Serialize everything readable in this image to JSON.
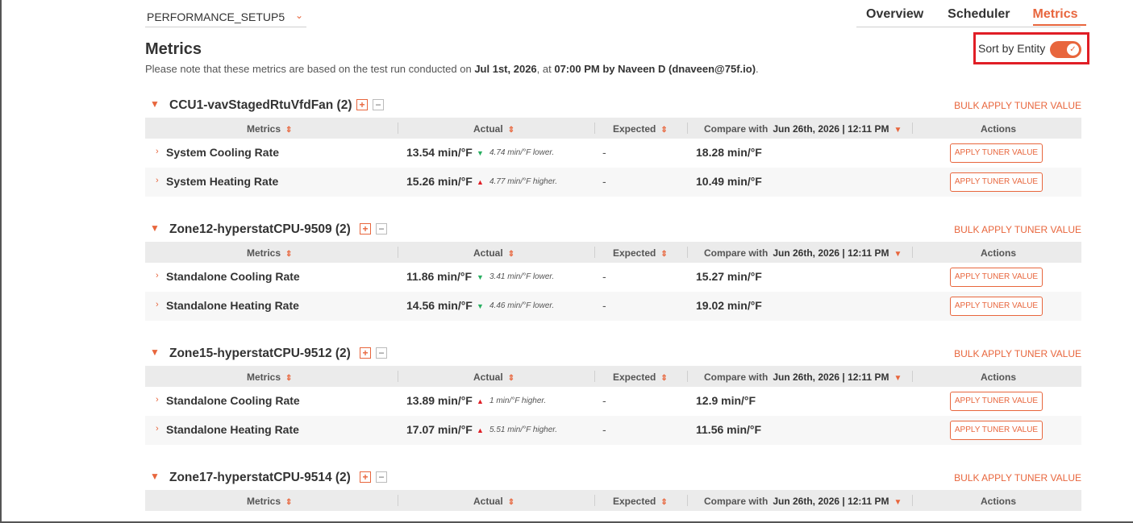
{
  "header": {
    "setup_select": "PERFORMANCE_SETUP5",
    "tabs": [
      {
        "label": "Overview",
        "active": false
      },
      {
        "label": "Scheduler",
        "active": false
      },
      {
        "label": "Metrics",
        "active": true
      }
    ]
  },
  "page": {
    "title": "Metrics",
    "note_prefix": "Please note that these metrics are based on the test run conducted on ",
    "note_date": "Jul 1st, 2026",
    "note_mid": ", at ",
    "note_time": "07:00 PM",
    "note_by": " by ",
    "note_user": "Naveen D (dnaveen@75f.io)",
    "note_suffix": "."
  },
  "sort": {
    "label": "Sort by Entity",
    "enabled": true
  },
  "table_headers": {
    "metrics": "Metrics",
    "actual": "Actual",
    "expected": "Expected",
    "compare_with": "Compare with",
    "compare_date": "Jun 26th, 2026 | 12:11 PM",
    "actions": "Actions"
  },
  "colors": {
    "accent": "#e8663d",
    "highlight": "#e01e26",
    "down": "#27ae60",
    "up": "#e01e26"
  },
  "sections": [
    {
      "title": "CCU1-vavStagedRtuVfdFan (2)",
      "bulk_label": "BULK APPLY TUNER VALUE",
      "rows": [
        {
          "name": "System Cooling Rate",
          "actual": "13.54 min/°F",
          "trend": "down",
          "diff": "4.74 min/°F lower.",
          "expected": "-",
          "compare": "18.28 min/°F",
          "action": "APPLY TUNER VALUE"
        },
        {
          "name": "System Heating Rate",
          "actual": "15.26 min/°F",
          "trend": "up",
          "diff": "4.77 min/°F higher.",
          "expected": "-",
          "compare": "10.49 min/°F",
          "action": "APPLY TUNER VALUE"
        }
      ]
    },
    {
      "title": "Zone12-hyperstatCPU-9509 (2)",
      "bulk_label": "BULK APPLY TUNER VALUE",
      "rows": [
        {
          "name": "Standalone Cooling Rate",
          "actual": "11.86 min/°F",
          "trend": "down",
          "diff": "3.41 min/°F lower.",
          "expected": "-",
          "compare": "15.27 min/°F",
          "action": "APPLY TUNER VALUE"
        },
        {
          "name": "Standalone Heating Rate",
          "actual": "14.56 min/°F",
          "trend": "down",
          "diff": "4.46 min/°F lower.",
          "expected": "-",
          "compare": "19.02 min/°F",
          "action": "APPLY TUNER VALUE"
        }
      ]
    },
    {
      "title": "Zone15-hyperstatCPU-9512 (2)",
      "bulk_label": "BULK APPLY TUNER VALUE",
      "rows": [
        {
          "name": "Standalone Cooling Rate",
          "actual": "13.89 min/°F",
          "trend": "up",
          "diff": "1 min/°F higher.",
          "expected": "-",
          "compare": "12.9 min/°F",
          "action": "APPLY TUNER VALUE"
        },
        {
          "name": "Standalone Heating Rate",
          "actual": "17.07 min/°F",
          "trend": "up",
          "diff": "5.51 min/°F higher.",
          "expected": "-",
          "compare": "11.56 min/°F",
          "action": "APPLY TUNER VALUE"
        }
      ]
    },
    {
      "title": "Zone17-hyperstatCPU-9514 (2)",
      "bulk_label": "BULK APPLY TUNER VALUE",
      "rows": []
    }
  ]
}
